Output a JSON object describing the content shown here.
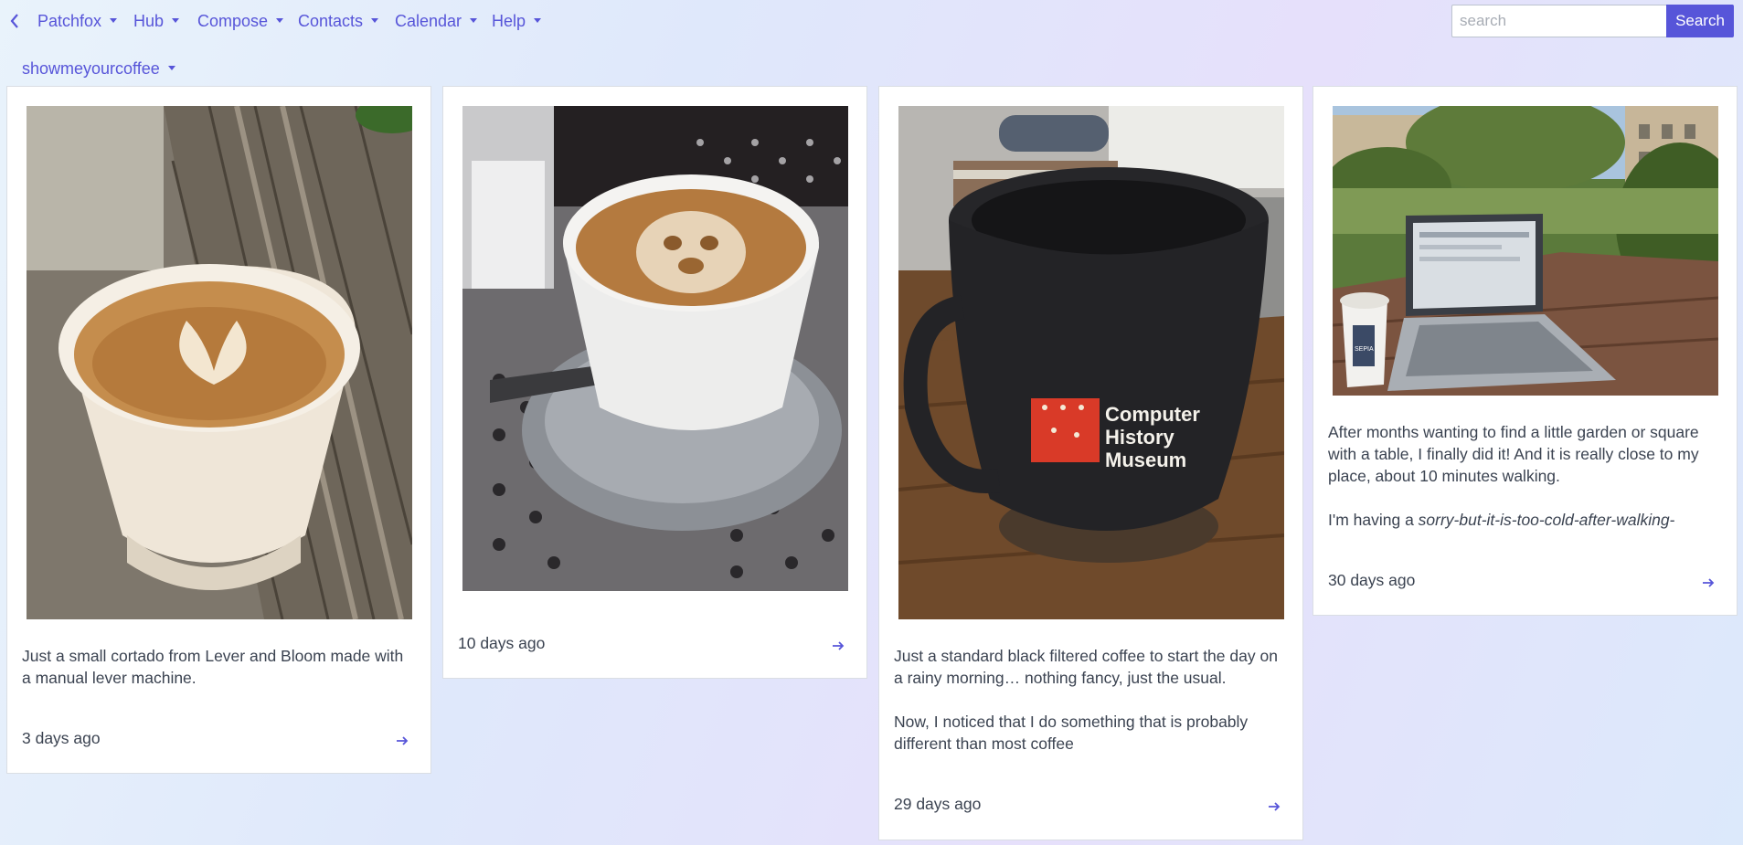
{
  "nav": {
    "items": [
      {
        "label": "Patchfox"
      },
      {
        "label": "Hub"
      },
      {
        "label": "Compose"
      },
      {
        "label": "Contacts"
      },
      {
        "label": "Calendar"
      },
      {
        "label": "Help"
      }
    ]
  },
  "search": {
    "placeholder": "search",
    "value": "",
    "button": "Search"
  },
  "channel": {
    "label": "showmeyourcoffee"
  },
  "posts": [
    {
      "paragraphs": [
        "Just a small cortado from Lever and Bloom made with a manual lever machine."
      ],
      "time": "3 days ago"
    },
    {
      "paragraphs": [],
      "time": "10 days ago"
    },
    {
      "paragraphs": [
        "Just a standard black filtered coffee to start the day on a rainy morning… nothing fancy, just the usual.",
        "Now, I noticed that I do something that is probably different than most coffee"
      ],
      "time": "29 days ago"
    },
    {
      "paragraphs": [
        "After months wanting to find a little garden or square with a table, I finally did it! And it is really close to my place, about 10 minutes walking."
      ],
      "italic_prefix": "I'm having a ",
      "italic_text": "sorry-but-it-is-too-cold-after-walking-",
      "time": "30 days ago"
    }
  ],
  "photo_mug_text": {
    "line1": "Computer",
    "line2": "History",
    "line3": "Museum"
  },
  "photo_cup_text": "SEPIA",
  "colors": {
    "accent": "#5755d9",
    "text": "#3b4351",
    "border": "#dadee4"
  },
  "icons": {
    "back": "chevron-left-icon",
    "caret": "caret-down-icon",
    "open": "arrow-right-icon"
  }
}
